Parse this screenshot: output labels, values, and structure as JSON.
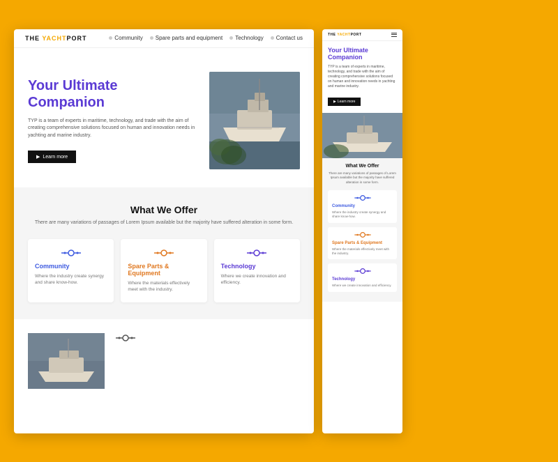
{
  "brand": {
    "name": "THE YACHT PORT",
    "name_styled": "THE YACHT",
    "name_accent": "PORT"
  },
  "nav": {
    "links": [
      {
        "label": "Community",
        "icon": "dot"
      },
      {
        "label": "Spare parts and equipment",
        "icon": "dot"
      },
      {
        "label": "Technology",
        "icon": "dot"
      },
      {
        "label": "Contact us",
        "icon": "dot"
      }
    ]
  },
  "hero": {
    "title_line1": "Your Ultimate",
    "title_line2": "Companion",
    "description": "TYP is a team of experts in maritime, technology, and trade with the aim of creating comprehensive solutions focused on human and innovation needs in yachting and marine industry.",
    "cta_label": "Learn more"
  },
  "offer_section": {
    "title": "What We Offer",
    "description": "There are many variations of passages of Lorem Ipsum available but the majority have suffered alteration in some form.",
    "cards": [
      {
        "title": "Community",
        "title_color": "blue",
        "description": "Where the industry create synergy and share know-how."
      },
      {
        "title": "Spare Parts & Equipment",
        "title_color": "orange",
        "description": "Where the materials effectively meet with the industry."
      },
      {
        "title": "Technology",
        "title_color": "purple",
        "description": "Where we create innovation and efficiency."
      }
    ]
  },
  "colors": {
    "accent_yellow": "#F5A800",
    "title_purple": "#5B3BD4",
    "community_blue": "#3D5AE0",
    "equipment_orange": "#E07820",
    "technology_purple": "#5B3BD4",
    "dark": "#111111"
  }
}
